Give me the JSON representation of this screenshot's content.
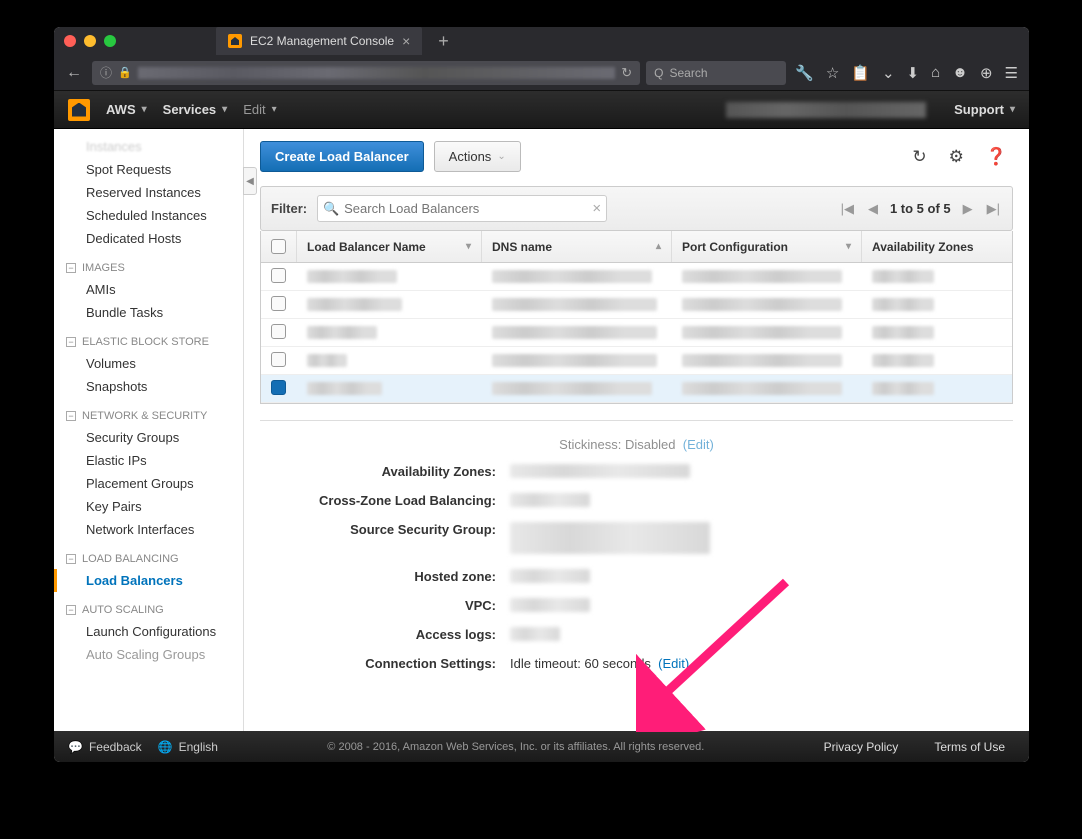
{
  "browser": {
    "tab_title": "EC2 Management Console",
    "search_placeholder": "Search"
  },
  "aws_header": {
    "menu_aws": "AWS",
    "menu_services": "Services",
    "menu_edit": "Edit",
    "menu_support": "Support"
  },
  "sidebar": {
    "instances": "Instances",
    "spot_requests": "Spot Requests",
    "reserved_instances": "Reserved Instances",
    "scheduled_instances": "Scheduled Instances",
    "dedicated_hosts": "Dedicated Hosts",
    "images_head": "IMAGES",
    "amis": "AMIs",
    "bundle_tasks": "Bundle Tasks",
    "ebs_head": "ELASTIC BLOCK STORE",
    "volumes": "Volumes",
    "snapshots": "Snapshots",
    "netsec_head": "NETWORK & SECURITY",
    "security_groups": "Security Groups",
    "elastic_ips": "Elastic IPs",
    "placement_groups": "Placement Groups",
    "key_pairs": "Key Pairs",
    "network_interfaces": "Network Interfaces",
    "lb_head": "LOAD BALANCING",
    "load_balancers": "Load Balancers",
    "as_head": "AUTO SCALING",
    "launch_configs": "Launch Configurations",
    "asg": "Auto Scaling Groups"
  },
  "actions": {
    "create": "Create Load Balancer",
    "actions": "Actions"
  },
  "filter": {
    "label": "Filter:",
    "placeholder": "Search Load Balancers"
  },
  "pager": {
    "text": "1 to 5 of 5"
  },
  "table": {
    "col_name": "Load Balancer Name",
    "col_dns": "DNS name",
    "col_port": "Port Configuration",
    "col_az": "Availability Zones"
  },
  "details": {
    "stickiness_label": "Stickiness:",
    "stickiness_value": "Disabled",
    "edit": "(Edit)",
    "az_label": "Availability Zones:",
    "crosszone_label": "Cross-Zone Load Balancing:",
    "ssg_label": "Source Security Group:",
    "hostedzone_label": "Hosted zone:",
    "vpc_label": "VPC:",
    "accesslogs_label": "Access logs:",
    "conn_label": "Connection Settings:",
    "conn_value": "Idle timeout: 60 seconds"
  },
  "footer": {
    "feedback": "Feedback",
    "english": "English",
    "copyright": "© 2008 - 2016, Amazon Web Services, Inc. or its affiliates. All rights reserved.",
    "privacy": "Privacy Policy",
    "terms": "Terms of Use"
  }
}
